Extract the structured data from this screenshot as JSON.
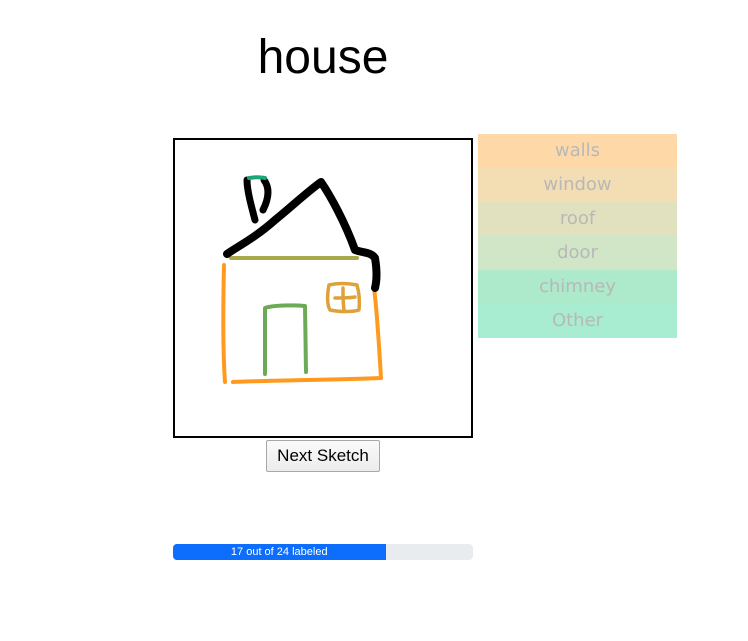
{
  "page": {
    "title": "house"
  },
  "labels": [
    {
      "text": "walls",
      "color": "#ffd8a8"
    },
    {
      "text": "window",
      "color": "#f3ddb2"
    },
    {
      "text": "roof",
      "color": "#e2e1bf"
    },
    {
      "text": "door",
      "color": "#d0e6c6"
    },
    {
      "text": "chimney",
      "color": "#ade9cb"
    },
    {
      "text": "Other",
      "color": "#a8ecd2"
    }
  ],
  "label_text_color": "#b8b8b8",
  "next_button": {
    "label": "Next Sketch"
  },
  "progress": {
    "label": "17 out of 24 labeled",
    "labeled": 17,
    "total": 24,
    "fill_color": "#0d6efd",
    "track_color": "#e9ecef"
  },
  "sketch": {
    "stroke_colors": {
      "walls": "#ff9a1f",
      "window": "#dfa23a",
      "roof": "#000000",
      "roof_base": "#a7a94b",
      "door": "#6daa55",
      "chimney": "#000000",
      "chimney_top": "#1ca673"
    }
  }
}
